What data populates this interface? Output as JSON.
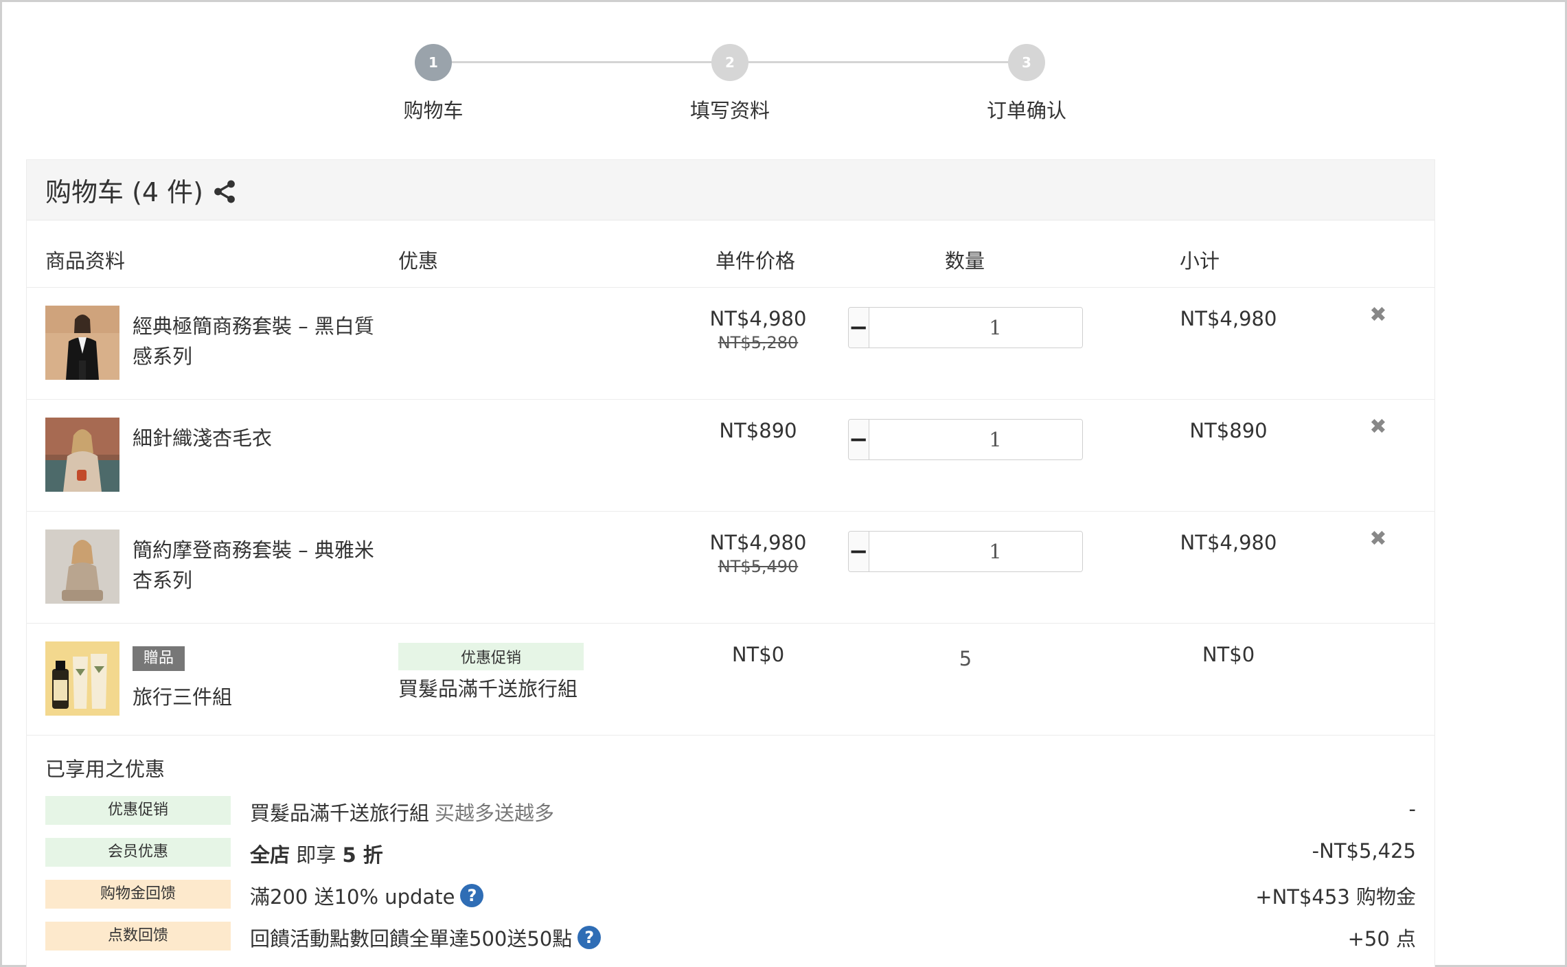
{
  "steps": [
    {
      "number": "1",
      "label": "购物车",
      "active": true
    },
    {
      "number": "2",
      "label": "填写资料",
      "active": false
    },
    {
      "number": "3",
      "label": "订单确认",
      "active": false
    }
  ],
  "cart": {
    "title": "购物车 (4 件)",
    "share_icon": "share-icon",
    "columns": {
      "product": "商品资料",
      "promotion": "优惠",
      "unit_price": "单件价格",
      "quantity": "数量",
      "subtotal": "小计"
    },
    "items": [
      {
        "name": "經典極簡商務套裝 – 黑白質感系列",
        "price": "NT$4,980",
        "original_price": "NT$5,280",
        "quantity": "1",
        "subtotal": "NT$4,980"
      },
      {
        "name": "細針織淺杏毛衣",
        "price": "NT$890",
        "original_price": "",
        "quantity": "1",
        "subtotal": "NT$890"
      },
      {
        "name": "簡約摩登商務套裝 – 典雅米杏系列",
        "price": "NT$4,980",
        "original_price": "NT$5,490",
        "quantity": "1",
        "subtotal": "NT$4,980"
      }
    ],
    "gift": {
      "badge": "贈品",
      "name": "旅行三件組",
      "promo_tag": "优惠促销",
      "promo_text": "買髮品滿千送旅行組",
      "price": "NT$0",
      "quantity": "5",
      "subtotal": "NT$0"
    }
  },
  "applied": {
    "title": "已享用之优惠",
    "rows": [
      {
        "tag": "优惠促销",
        "text": "買髮品滿千送旅行組",
        "muted": "买越多送越多",
        "value": "-"
      },
      {
        "tag": "会员优惠",
        "bold": "全店",
        "text": " 即享 ",
        "bold2": "5 折",
        "value": "-NT$5,425"
      },
      {
        "tag": "购物金回馈",
        "text": "滿200 送10% update",
        "value": "+NT$453 购物金"
      },
      {
        "tag": "点数回馈",
        "text": "回饋活動點數回饋全單達500送50點",
        "value": "+50 点"
      }
    ]
  },
  "colors": {
    "green_tag": "#e6f5e6",
    "orange_tag": "#fde9cc",
    "help_icon": "#2f6db5",
    "step_active": "#9aa3ab",
    "step_inactive": "#d6d6d6"
  }
}
